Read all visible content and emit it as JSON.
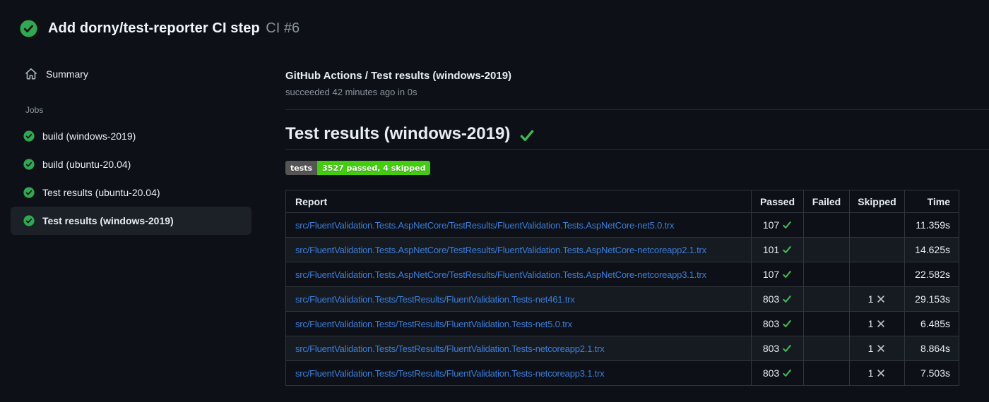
{
  "header": {
    "title": "Add dorny/test-reporter CI step",
    "run_number": "CI #6",
    "status_icon": "check-circle-icon"
  },
  "sidebar": {
    "summary_label": "Summary",
    "summary_icon": "home-icon",
    "jobs_label": "Jobs",
    "jobs": [
      {
        "label": "build (windows-2019)",
        "selected": false,
        "icon": "check-circle-icon"
      },
      {
        "label": "build (ubuntu-20.04)",
        "selected": false,
        "icon": "check-circle-icon"
      },
      {
        "label": "Test results (ubuntu-20.04)",
        "selected": false,
        "icon": "check-circle-icon"
      },
      {
        "label": "Test results (windows-2019)",
        "selected": true,
        "icon": "check-circle-icon"
      }
    ]
  },
  "main": {
    "check_name": "GitHub Actions / Test results (windows-2019)",
    "check_status": "succeeded 42 minutes ago in 0s",
    "section_title": "Test results (windows-2019)",
    "section_status_icon": "success-check-icon",
    "badge": {
      "label": "tests",
      "value": "3527 passed, 4 skipped",
      "label_bg": "#555555",
      "value_bg": "#44cc11"
    },
    "table": {
      "columns": [
        "Report",
        "Passed",
        "Failed",
        "Skipped",
        "Time"
      ],
      "rows": [
        {
          "report": "src/FluentValidation.Tests.AspNetCore/TestResults/FluentValidation.Tests.AspNetCore-net5.0.trx",
          "passed": "107",
          "failed": "",
          "skipped": "",
          "time": "11.359s"
        },
        {
          "report": "src/FluentValidation.Tests.AspNetCore/TestResults/FluentValidation.Tests.AspNetCore-netcoreapp2.1.trx",
          "passed": "101",
          "failed": "",
          "skipped": "",
          "time": "14.625s"
        },
        {
          "report": "src/FluentValidation.Tests.AspNetCore/TestResults/FluentValidation.Tests.AspNetCore-netcoreapp3.1.trx",
          "passed": "107",
          "failed": "",
          "skipped": "",
          "time": "22.582s"
        },
        {
          "report": "src/FluentValidation.Tests/TestResults/FluentValidation.Tests-net461.trx",
          "passed": "803",
          "failed": "",
          "skipped": "1",
          "time": "29.153s"
        },
        {
          "report": "src/FluentValidation.Tests/TestResults/FluentValidation.Tests-net5.0.trx",
          "passed": "803",
          "failed": "",
          "skipped": "1",
          "time": "6.485s"
        },
        {
          "report": "src/FluentValidation.Tests/TestResults/FluentValidation.Tests-netcoreapp2.1.trx",
          "passed": "803",
          "failed": "",
          "skipped": "1",
          "time": "8.864s"
        },
        {
          "report": "src/FluentValidation.Tests/TestResults/FluentValidation.Tests-netcoreapp3.1.trx",
          "passed": "803",
          "failed": "",
          "skipped": "1",
          "time": "7.503s"
        }
      ]
    }
  },
  "colors": {
    "page_bg": "#0d1117",
    "row_alt_bg": "#161b22",
    "selected_item_bg": "#1c2128",
    "table_border": "#30363d",
    "divider": "#262d36",
    "text_primary": "#e6edf3",
    "text_secondary": "#8b949e",
    "success_circle": "#2ea950",
    "success_check": "#3fb950",
    "link_blue": "#3b7dd8",
    "skip_x_gray": "#bac1ca",
    "badge_label_bg": "#555555",
    "badge_value_bg": "#44cc11"
  }
}
